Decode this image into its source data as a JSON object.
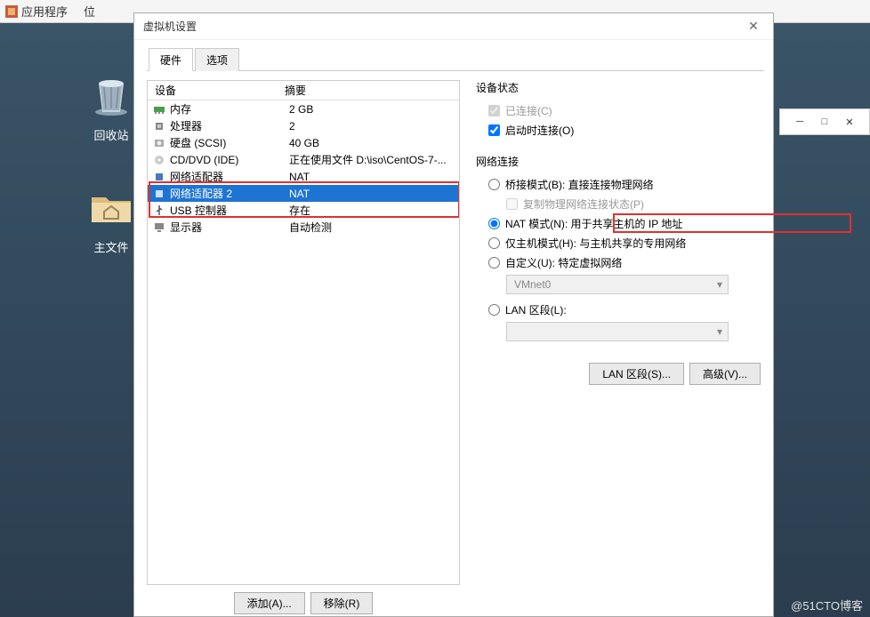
{
  "taskbar": {
    "apps_label": "应用程序",
    "places_label": "位",
    "places_full": "位置"
  },
  "desktop": {
    "trash_label": "回收站",
    "home_label": "主文件夹",
    "home_visible": "主文件"
  },
  "dialog": {
    "title": "虚拟机设置",
    "tab_hardware": "硬件",
    "tab_options": "选项",
    "header_device": "设备",
    "header_summary": "摘要",
    "devices": [
      {
        "name": "内存",
        "summary": "2 GB",
        "icon": "memory"
      },
      {
        "name": "处理器",
        "summary": "2",
        "icon": "cpu"
      },
      {
        "name": "硬盘 (SCSI)",
        "summary": "40 GB",
        "icon": "disk"
      },
      {
        "name": "CD/DVD (IDE)",
        "summary": "正在使用文件 D:\\iso\\CentOS-7-...",
        "icon": "cd"
      },
      {
        "name": "网络适配器",
        "summary": "NAT",
        "icon": "net"
      },
      {
        "name": "网络适配器 2",
        "summary": "NAT",
        "icon": "net",
        "selected": true
      },
      {
        "name": "USB 控制器",
        "summary": "存在",
        "icon": "usb"
      },
      {
        "name": "显示器",
        "summary": "自动检测",
        "icon": "display"
      }
    ],
    "add_btn": "添加(A)...",
    "remove_btn": "移除(R)"
  },
  "right": {
    "device_status_title": "设备状态",
    "connected": "已连接(C)",
    "connect_at_poweron": "启动时连接(O)",
    "net_conn_title": "网络连接",
    "bridged": "桥接模式(B): 直接连接物理网络",
    "replicate_phys": "复制物理网络连接状态(P)",
    "nat": "NAT 模式(N): 用于共享主机的 IP 地址",
    "hostonly": "仅主机模式(H): 与主机共享的专用网络",
    "custom": "自定义(U): 特定虚拟网络",
    "vmnet_value": "VMnet0",
    "lan_segment": "LAN 区段(L):",
    "lan_seg_btn": "LAN 区段(S)...",
    "advanced_btn": "高级(V)..."
  },
  "watermark": "@51CTO博客"
}
